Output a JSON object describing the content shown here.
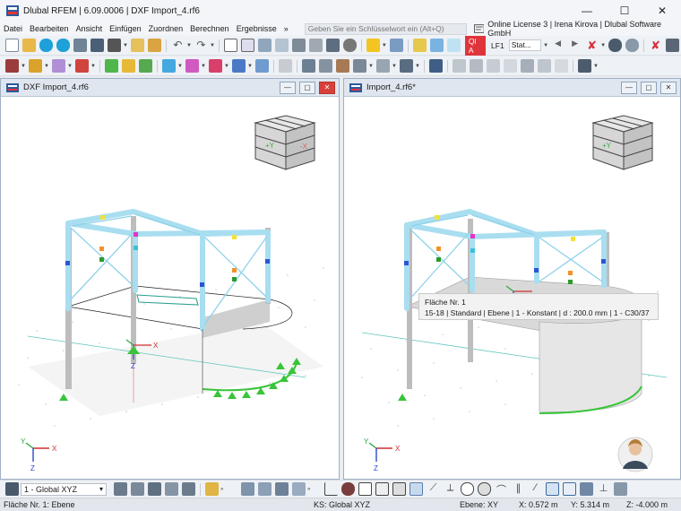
{
  "titlebar": {
    "title": "Dlubal RFEM | 6.09.0006 | DXF Import_4.rf6",
    "minimize": "—",
    "maximize": "☐",
    "close": "✕"
  },
  "menu": {
    "items": [
      "Datei",
      "Bearbeiten",
      "Ansicht",
      "Einfügen",
      "Zuordnen",
      "Berechnen",
      "Ergebnisse"
    ],
    "search_placeholder": "Geben Sie ein Schlüsselwort ein (Alt+Q)",
    "license": "Online License 3 | Irena Kirova | Dlubal Software GmbH"
  },
  "toolbar2": {
    "load_badge": "Ql A",
    "load_case": "LF1",
    "stat_select": "Stat..."
  },
  "panels": {
    "left": {
      "title": "DXF Import_4.rf6",
      "min": "—",
      "max": "▢",
      "close": "✕"
    },
    "right": {
      "title": "Import_4.rf6*",
      "min": "—",
      "max": "▢",
      "close": "✕"
    }
  },
  "viewcube": {
    "axis_y": "+Y",
    "axis_x": "-X"
  },
  "axes": {
    "x": "X",
    "y": "Y",
    "z": "Z"
  },
  "tooltip": {
    "line1": "Fläche Nr. 1",
    "line2": "15-18 | Standard | Ebene | 1 - Konstant | d : 200.0 mm | 1 - C30/37"
  },
  "statusbar": {
    "coord_system": "1 - Global XYZ",
    "left_info": "Fläche Nr. 1: Ebene",
    "ks": "KS: Global XYZ",
    "plane": "Ebene: XY",
    "x": "X: 0.572 m",
    "y": "Y: 5.314 m",
    "z": "Z: -4.000 m"
  },
  "colors": {
    "accent": "#3d6aa8",
    "member": "#a9def0",
    "support": "#39c43a"
  }
}
